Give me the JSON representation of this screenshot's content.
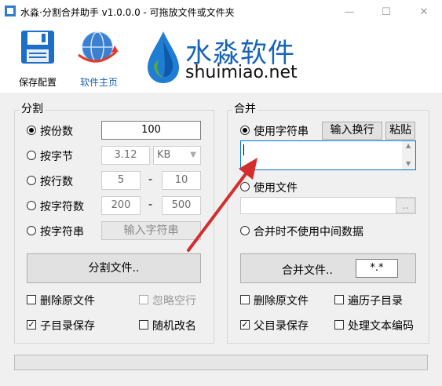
{
  "window": {
    "title": "水淼·分割合并助手 v1.0.0.0 - 可拖放文件或文件夹",
    "minimize": "—",
    "maximize": "☐",
    "close": "✕"
  },
  "toolbar": {
    "save_config": "保存配置",
    "homepage": "软件主页"
  },
  "brand": {
    "name_cn": "水淼软件",
    "name_en": "shuimiao.net"
  },
  "split": {
    "title": "分割",
    "by_parts_label": "按份数",
    "by_parts_value": "100",
    "by_bytes_label": "按字节",
    "by_bytes_value": "3.12",
    "byte_unit": "KB",
    "by_lines_label": "按行数",
    "lines_from": "5",
    "lines_to": "10",
    "by_chars_label": "按字符数",
    "chars_from": "200",
    "chars_to": "500",
    "range_sep": "-",
    "by_string_label": "按字符串",
    "string_button": "输入字符串",
    "split_button": "分割文件..",
    "delete_original": "删除原文件",
    "ignore_blank": "忽略空行",
    "subdir_save": "子目录保存",
    "random_rename": "随机改名"
  },
  "merge": {
    "title": "合并",
    "use_string_label": "使用字符串",
    "input_newline_button": "输入换行",
    "paste_button": "粘贴",
    "string_value": "",
    "use_file_label": "使用文件",
    "file_value": "",
    "browse_button": "..",
    "no_temp_label": "合并时不使用中间数据",
    "merge_button": "合并文件..",
    "pattern_value": "*.*",
    "delete_original": "删除原文件",
    "traverse_subdirs": "遍历子目录",
    "parent_dir_save": "父目录保存",
    "process_encoding": "处理文本编码"
  },
  "colors": {
    "accent": "#1764b9",
    "arrow": "#d32f2f",
    "focus": "#0078d7"
  }
}
